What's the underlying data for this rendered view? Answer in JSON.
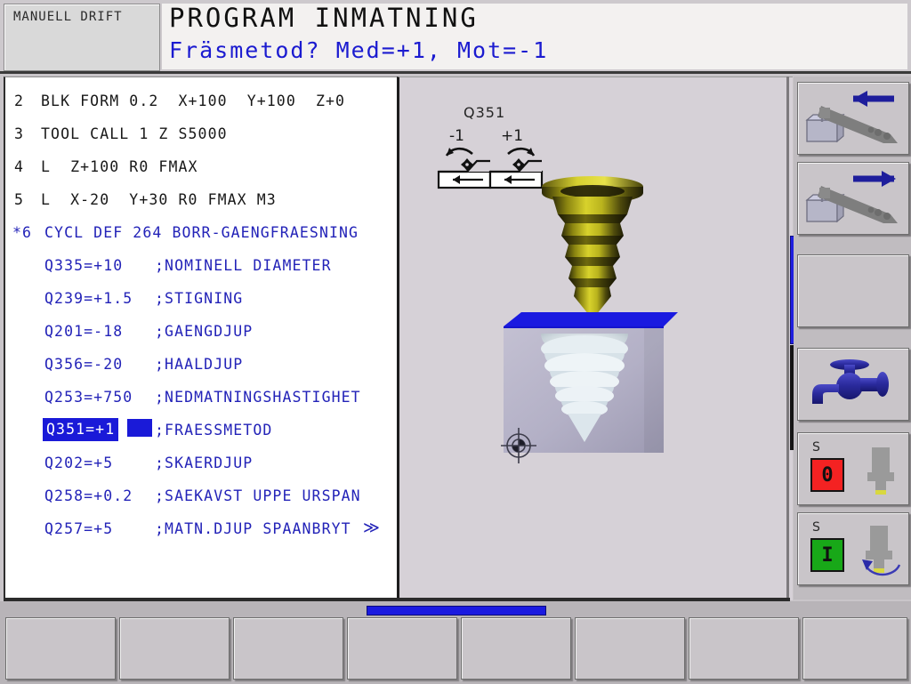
{
  "header": {
    "mode_label": "MANUELL DRIFT",
    "title": "PROGRAM INMATNING",
    "prompt": "Fräsmetod? Med=+1, Mot=-1"
  },
  "colors": {
    "blue_text": "#2323b8",
    "black_text": "#181818",
    "selection": "#1a1ad8",
    "panel_bg": "#d6d1d7",
    "list_bg": "#ffffff",
    "chrome": "#c9c5c9",
    "status_red": "#f42222",
    "status_green": "#18a818",
    "workpiece_blue": "#1a1ae0",
    "screw_yellow": "#b5b01a"
  },
  "program": {
    "lines": [
      {
        "num": "2",
        "text": "BLK FORM 0.2  X+100  Y+100  Z+0",
        "color": "black",
        "kind": "block"
      },
      {
        "num": "3",
        "text": "TOOL CALL 1 Z S5000",
        "color": "black",
        "kind": "block"
      },
      {
        "num": "4",
        "text": "L  Z+100 R0 FMAX",
        "color": "black",
        "kind": "block"
      },
      {
        "num": "5",
        "text": "L  X-20  Y+30 R0 FMAX M3",
        "color": "black",
        "kind": "block"
      },
      {
        "num": "*6",
        "text": "CYCL DEF 264 BORR-GAENGFRAESNING",
        "color": "blue",
        "kind": "cycle"
      }
    ],
    "params": [
      {
        "name": "Q335=+10",
        "comment": ";NOMINELL DIAMETER",
        "selected": false
      },
      {
        "name": "Q239=+1.5",
        "comment": ";STIGNING",
        "selected": false
      },
      {
        "name": "Q201=-18",
        "comment": ";GAENGDJUP",
        "selected": false
      },
      {
        "name": "Q356=-20",
        "comment": ";HAALDJUP",
        "selected": false
      },
      {
        "name": "Q253=+750",
        "comment": ";NEDMATNINGSHASTIGHET",
        "selected": false
      },
      {
        "name": "Q351=+1",
        "comment": ";FRAESSMETOD",
        "selected": true
      },
      {
        "name": "Q202=+5",
        "comment": ";SKAERDJUP",
        "selected": false
      },
      {
        "name": "Q258=+0.2",
        "comment": ";SAEKAVST UPPE URSPAN",
        "selected": false
      },
      {
        "name": "Q257=+5",
        "comment": ";MATN.DJUP SPAANBRYT",
        "selected": false,
        "more": "≫"
      }
    ]
  },
  "graphic": {
    "parameter_label": "Q351",
    "option_minus": "-1",
    "option_plus": "+1",
    "icons": {
      "rotation_ccw": "conventional-milling-icon",
      "rotation_cw": "climb-milling-icon",
      "screw": "thread-screw-icon",
      "workpiece": "workpiece-thread-hole-icon",
      "origin": "datum-origin-icon"
    }
  },
  "softkeys_right": [
    {
      "id": "chip-conveyor-left",
      "icon": "chip-conveyor-arrow-left-icon"
    },
    {
      "id": "chip-conveyor-right",
      "icon": "chip-conveyor-arrow-right-icon"
    },
    {
      "id": "blank-key",
      "icon": ""
    },
    {
      "id": "coolant",
      "icon": "coolant-tap-icon"
    },
    {
      "id": "spindle-stop",
      "icon": "spindle-icon",
      "label": "S",
      "state": "0"
    },
    {
      "id": "spindle-start",
      "icon": "spindle-rotate-icon",
      "label": "S",
      "state": "I"
    }
  ],
  "softkeys_bottom": [
    {
      "id": "softkey-1",
      "label": ""
    },
    {
      "id": "softkey-2",
      "label": ""
    },
    {
      "id": "softkey-3",
      "label": ""
    },
    {
      "id": "softkey-4",
      "label": ""
    },
    {
      "id": "softkey-5",
      "label": ""
    },
    {
      "id": "softkey-6",
      "label": ""
    },
    {
      "id": "softkey-7",
      "label": ""
    },
    {
      "id": "softkey-8",
      "label": ""
    }
  ]
}
